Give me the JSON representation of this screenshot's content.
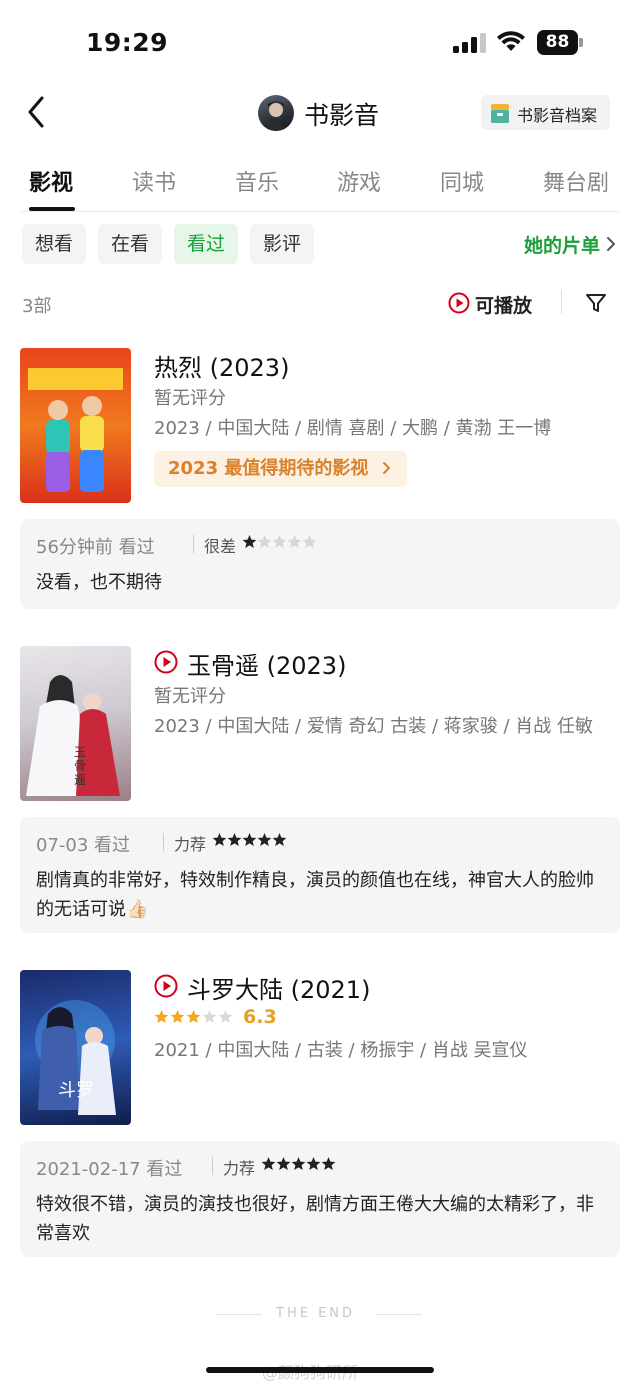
{
  "status_bar": {
    "time": "19:29",
    "battery": "88"
  },
  "header": {
    "title": "书影音",
    "archive_label": "书影音档案"
  },
  "tabs": [
    {
      "label": "影视",
      "active": true
    },
    {
      "label": "读书"
    },
    {
      "label": "音乐"
    },
    {
      "label": "游戏"
    },
    {
      "label": "同城"
    },
    {
      "label": "舞台剧"
    }
  ],
  "filters": [
    {
      "label": "想看"
    },
    {
      "label": "在看"
    },
    {
      "label": "看过",
      "active": true
    },
    {
      "label": "影评"
    }
  ],
  "her_list_label": "她的片单",
  "count_label": "3部",
  "playable_label": "可播放",
  "colors": {
    "accent_green": "#1a9f3a",
    "play_red": "#d0021b",
    "star_gold": "#f5a623"
  },
  "movies": [
    {
      "title": "热烈 (2023)",
      "rating_text": "暂无评分",
      "meta": "2023 / 中国大陆 / 剧情 喜剧 / 大鹏 / 黄渤 王一博",
      "promo": "2023 最值得期待的影视",
      "playable": false,
      "review": {
        "time": "56分钟前 看过",
        "rating_label": "很差",
        "stars": 1,
        "text": "没看，也不期待"
      }
    },
    {
      "title": "玉骨遥 (2023)",
      "rating_text": "暂无评分",
      "meta": "2023 / 中国大陆 / 爱情 奇幻 古装 / 蒋家骏 / 肖战 任敏",
      "playable": true,
      "review": {
        "time": "07-03 看过",
        "rating_label": "力荐",
        "stars": 5,
        "text": "剧情真的非常好，特效制作精良，演员的颜值也在线，神官大人的脸帅的无话可说👍🏻"
      }
    },
    {
      "title": "斗罗大陆 (2021)",
      "score": "6.3",
      "score_stars": 3,
      "meta": "2021 / 中国大陆 / 古装 / 杨振宇 / 肖战 吴宣仪",
      "playable": true,
      "review": {
        "time": "2021-02-17 看过",
        "rating_label": "力荐",
        "stars": 5,
        "text": "特效很不错，演员的演技也很好，剧情方面王倦大大编的太精彩了，非常喜欢"
      }
    }
  ],
  "footer": {
    "end_text": "THE END",
    "watermark": "@颜狗狗研所"
  }
}
